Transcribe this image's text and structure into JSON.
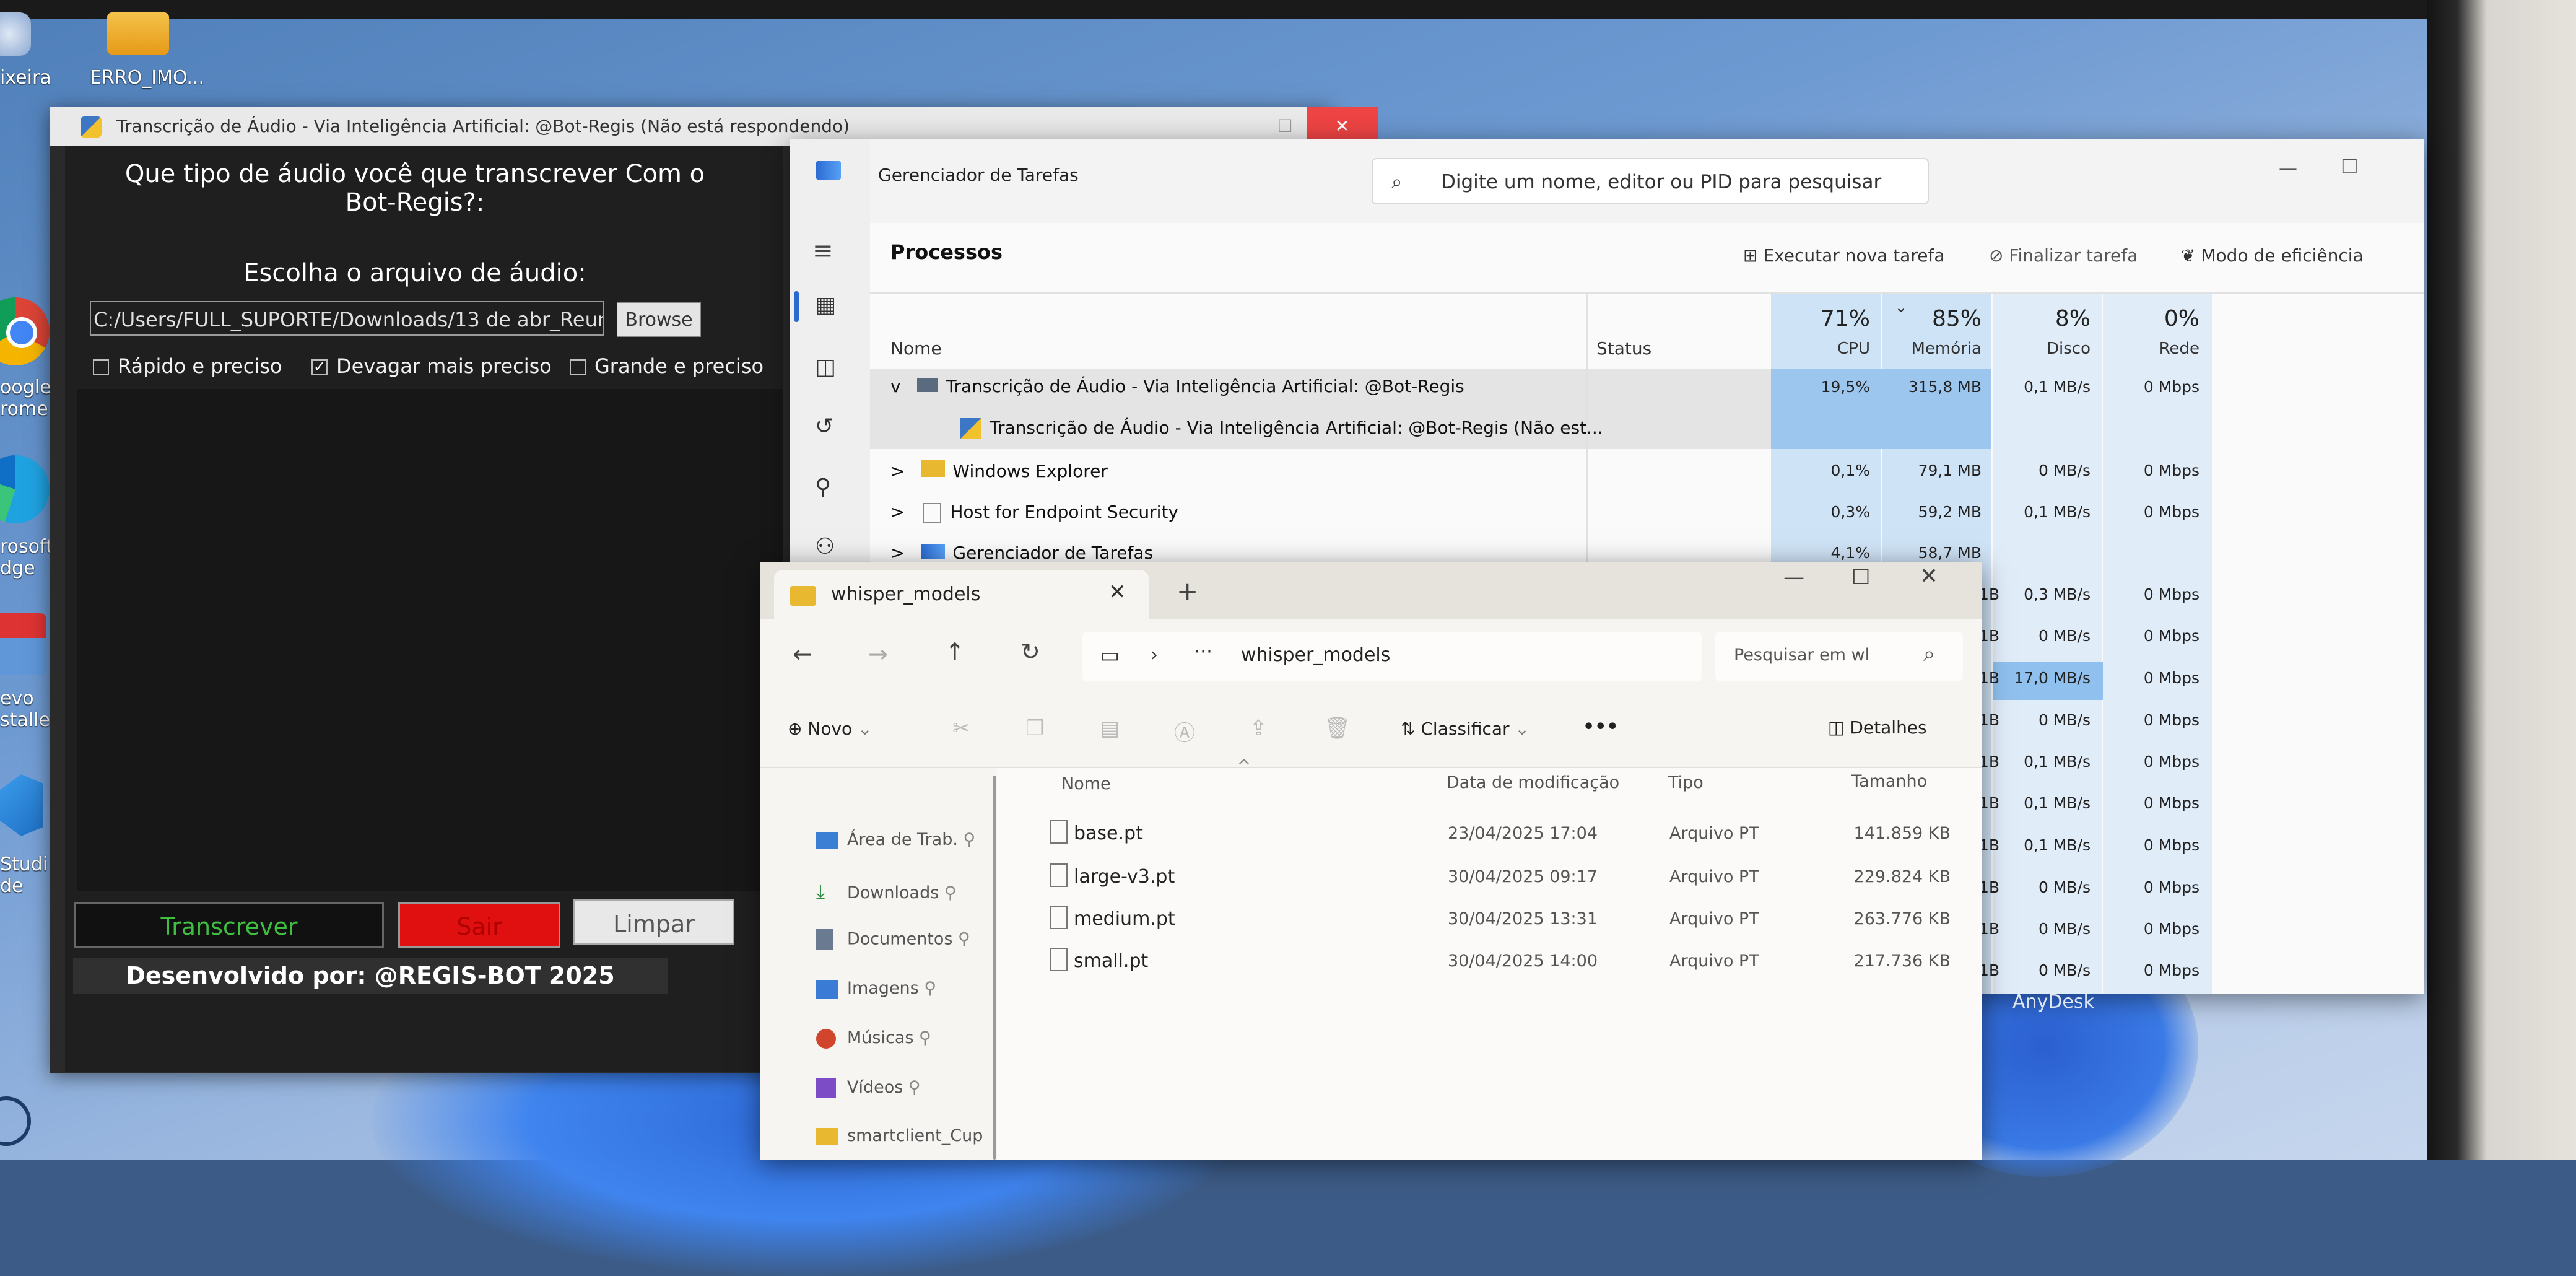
{
  "desktop": {
    "icons": [
      {
        "label": "ixeira",
        "icon": "recycle-bin-icon"
      },
      {
        "label": "ERRO_IMO...",
        "icon": "folder-icon"
      },
      {
        "label": "oogle\nrome",
        "icon": "chrome-icon"
      },
      {
        "label": "rosoft\ndge",
        "icon": "edge-icon"
      },
      {
        "label": "evo\nstaller",
        "icon": "installer-icon"
      },
      {
        "label": "Studi\nde",
        "icon": "vscode-icon"
      }
    ]
  },
  "tk_app": {
    "title": "Transcrição de Áudio - Via Inteligência Artificial: @Bot-Regis (Não está respondendo)",
    "question_line1": "Que tipo de áudio você que transcrever Com o",
    "question_line2": "Bot-Regis?:",
    "choose_file_label": "Escolha o arquivo de áudio:",
    "file_path": "C:/Users/FULL_SUPORTE/Downloads/13 de abr_Reuni",
    "browse_label": "Browse",
    "options": [
      {
        "label": "Rápido e preciso",
        "checked": false
      },
      {
        "label": "Devagar mais preciso",
        "checked": true
      },
      {
        "label": "Grande e preciso",
        "checked": false
      }
    ],
    "transcrever_label": "Transcrever",
    "sair_label": "Sair",
    "limpar_label": "Limpar",
    "footer": "Desenvolvido por: @REGIS-BOT 2025"
  },
  "task_manager": {
    "title": "Gerenciador de Tarefas",
    "search_placeholder": "Digite um nome, editor ou PID para pesquisar",
    "section": "Processos",
    "actions": {
      "new_task": "Executar nova tarefa",
      "end_task": "Finalizar tarefa",
      "efficiency": "Modo de eficiência"
    },
    "columns": {
      "name": "Nome",
      "status": "Status",
      "cpu": "CPU",
      "memory": "Memória",
      "disk": "Disco",
      "network": "Rede"
    },
    "totals": {
      "cpu": "71%",
      "memory": "85%",
      "disk": "8%",
      "network": "0%"
    },
    "rows": [
      {
        "name": "Transcrição de Áudio - Via Inteligência Artificial: @Bot-Regis",
        "cpu": "19,5%",
        "mem": "315,8 MB",
        "disk": "0,1 MB/s",
        "net": "0 Mbps",
        "expander": "v"
      },
      {
        "name": "Transcrição de Áudio - Via Inteligência Artificial: @Bot-Regis (Não est...",
        "cpu": "",
        "mem": "",
        "disk": "",
        "net": "",
        "expander": ""
      },
      {
        "name": "Windows Explorer",
        "cpu": "0,1%",
        "mem": "79,1 MB",
        "disk": "0 MB/s",
        "net": "0 Mbps",
        "expander": ">"
      },
      {
        "name": "Host for Endpoint Security",
        "cpu": "0,3%",
        "mem": "59,2 MB",
        "disk": "0,1 MB/s",
        "net": "0 Mbps",
        "expander": ">"
      },
      {
        "name": "Gerenciador de Tarefas",
        "cpu": "4,1%",
        "mem": "58,7 MB",
        "disk": "0 MB/s",
        "net": "0 Mbps",
        "expander": ">"
      }
    ],
    "partial_rows": [
      {
        "mem": "1B",
        "disk": "0,3 MB/s",
        "net": "0 Mbps"
      },
      {
        "mem": "1B",
        "disk": "0 MB/s",
        "net": "0 Mbps"
      },
      {
        "mem": "1B",
        "disk": "17,0 MB/s",
        "net": "0 Mbps"
      },
      {
        "mem": "1B",
        "disk": "0 MB/s",
        "net": "0 Mbps"
      },
      {
        "mem": "1B",
        "disk": "0,1 MB/s",
        "net": "0 Mbps"
      },
      {
        "mem": "1B",
        "disk": "0,1 MB/s",
        "net": "0 Mbps"
      },
      {
        "mem": "1B",
        "disk": "0,1 MB/s",
        "net": "0 Mbps"
      },
      {
        "mem": "1B",
        "disk": "0 MB/s",
        "net": "0 Mbps"
      },
      {
        "mem": "1B",
        "disk": "0 MB/s",
        "net": "0 Mbps"
      },
      {
        "mem": "1B",
        "disk": "0 MB/s",
        "net": "0 Mbps"
      }
    ]
  },
  "explorer": {
    "tab_title": "whisper_models",
    "address": "whisper_models",
    "search_placeholder": "Pesquisar em wl",
    "toolbar": {
      "new": "Novo",
      "sort": "Classificar",
      "more": "•••",
      "details": "Detalhes"
    },
    "columns": {
      "name": "Nome",
      "modified": "Data de modificação",
      "type": "Tipo",
      "size": "Tamanho"
    },
    "files": [
      {
        "name": "base.pt",
        "modified": "23/04/2025 17:04",
        "type": "Arquivo PT",
        "size": "141.859 KB"
      },
      {
        "name": "large-v3.pt",
        "modified": "30/04/2025 09:17",
        "type": "Arquivo PT",
        "size": "229.824 KB"
      },
      {
        "name": "medium.pt",
        "modified": "30/04/2025 13:31",
        "type": "Arquivo PT",
        "size": "263.776 KB"
      },
      {
        "name": "small.pt",
        "modified": "30/04/2025 14:00",
        "type": "Arquivo PT",
        "size": "217.736 KB"
      }
    ],
    "sidebar": [
      {
        "label": "Área de Trab.",
        "icon": "desktop-icon",
        "color": "#3b7fd4"
      },
      {
        "label": "Downloads",
        "icon": "download-icon",
        "color": "#2a8a3e"
      },
      {
        "label": "Documentos",
        "icon": "document-icon",
        "color": "#6a7a90"
      },
      {
        "label": "Imagens",
        "icon": "image-icon",
        "color": "#3a7bd5"
      },
      {
        "label": "Músicas",
        "icon": "music-icon",
        "color": "#d0452c"
      },
      {
        "label": "Vídeos",
        "icon": "video-icon",
        "color": "#7b4cc6"
      },
      {
        "label": "smartclient_Cup",
        "icon": "folder-icon",
        "color": "#e8b830"
      }
    ]
  },
  "taskbar_hint": {
    "anydesk": "AnyDesk"
  }
}
